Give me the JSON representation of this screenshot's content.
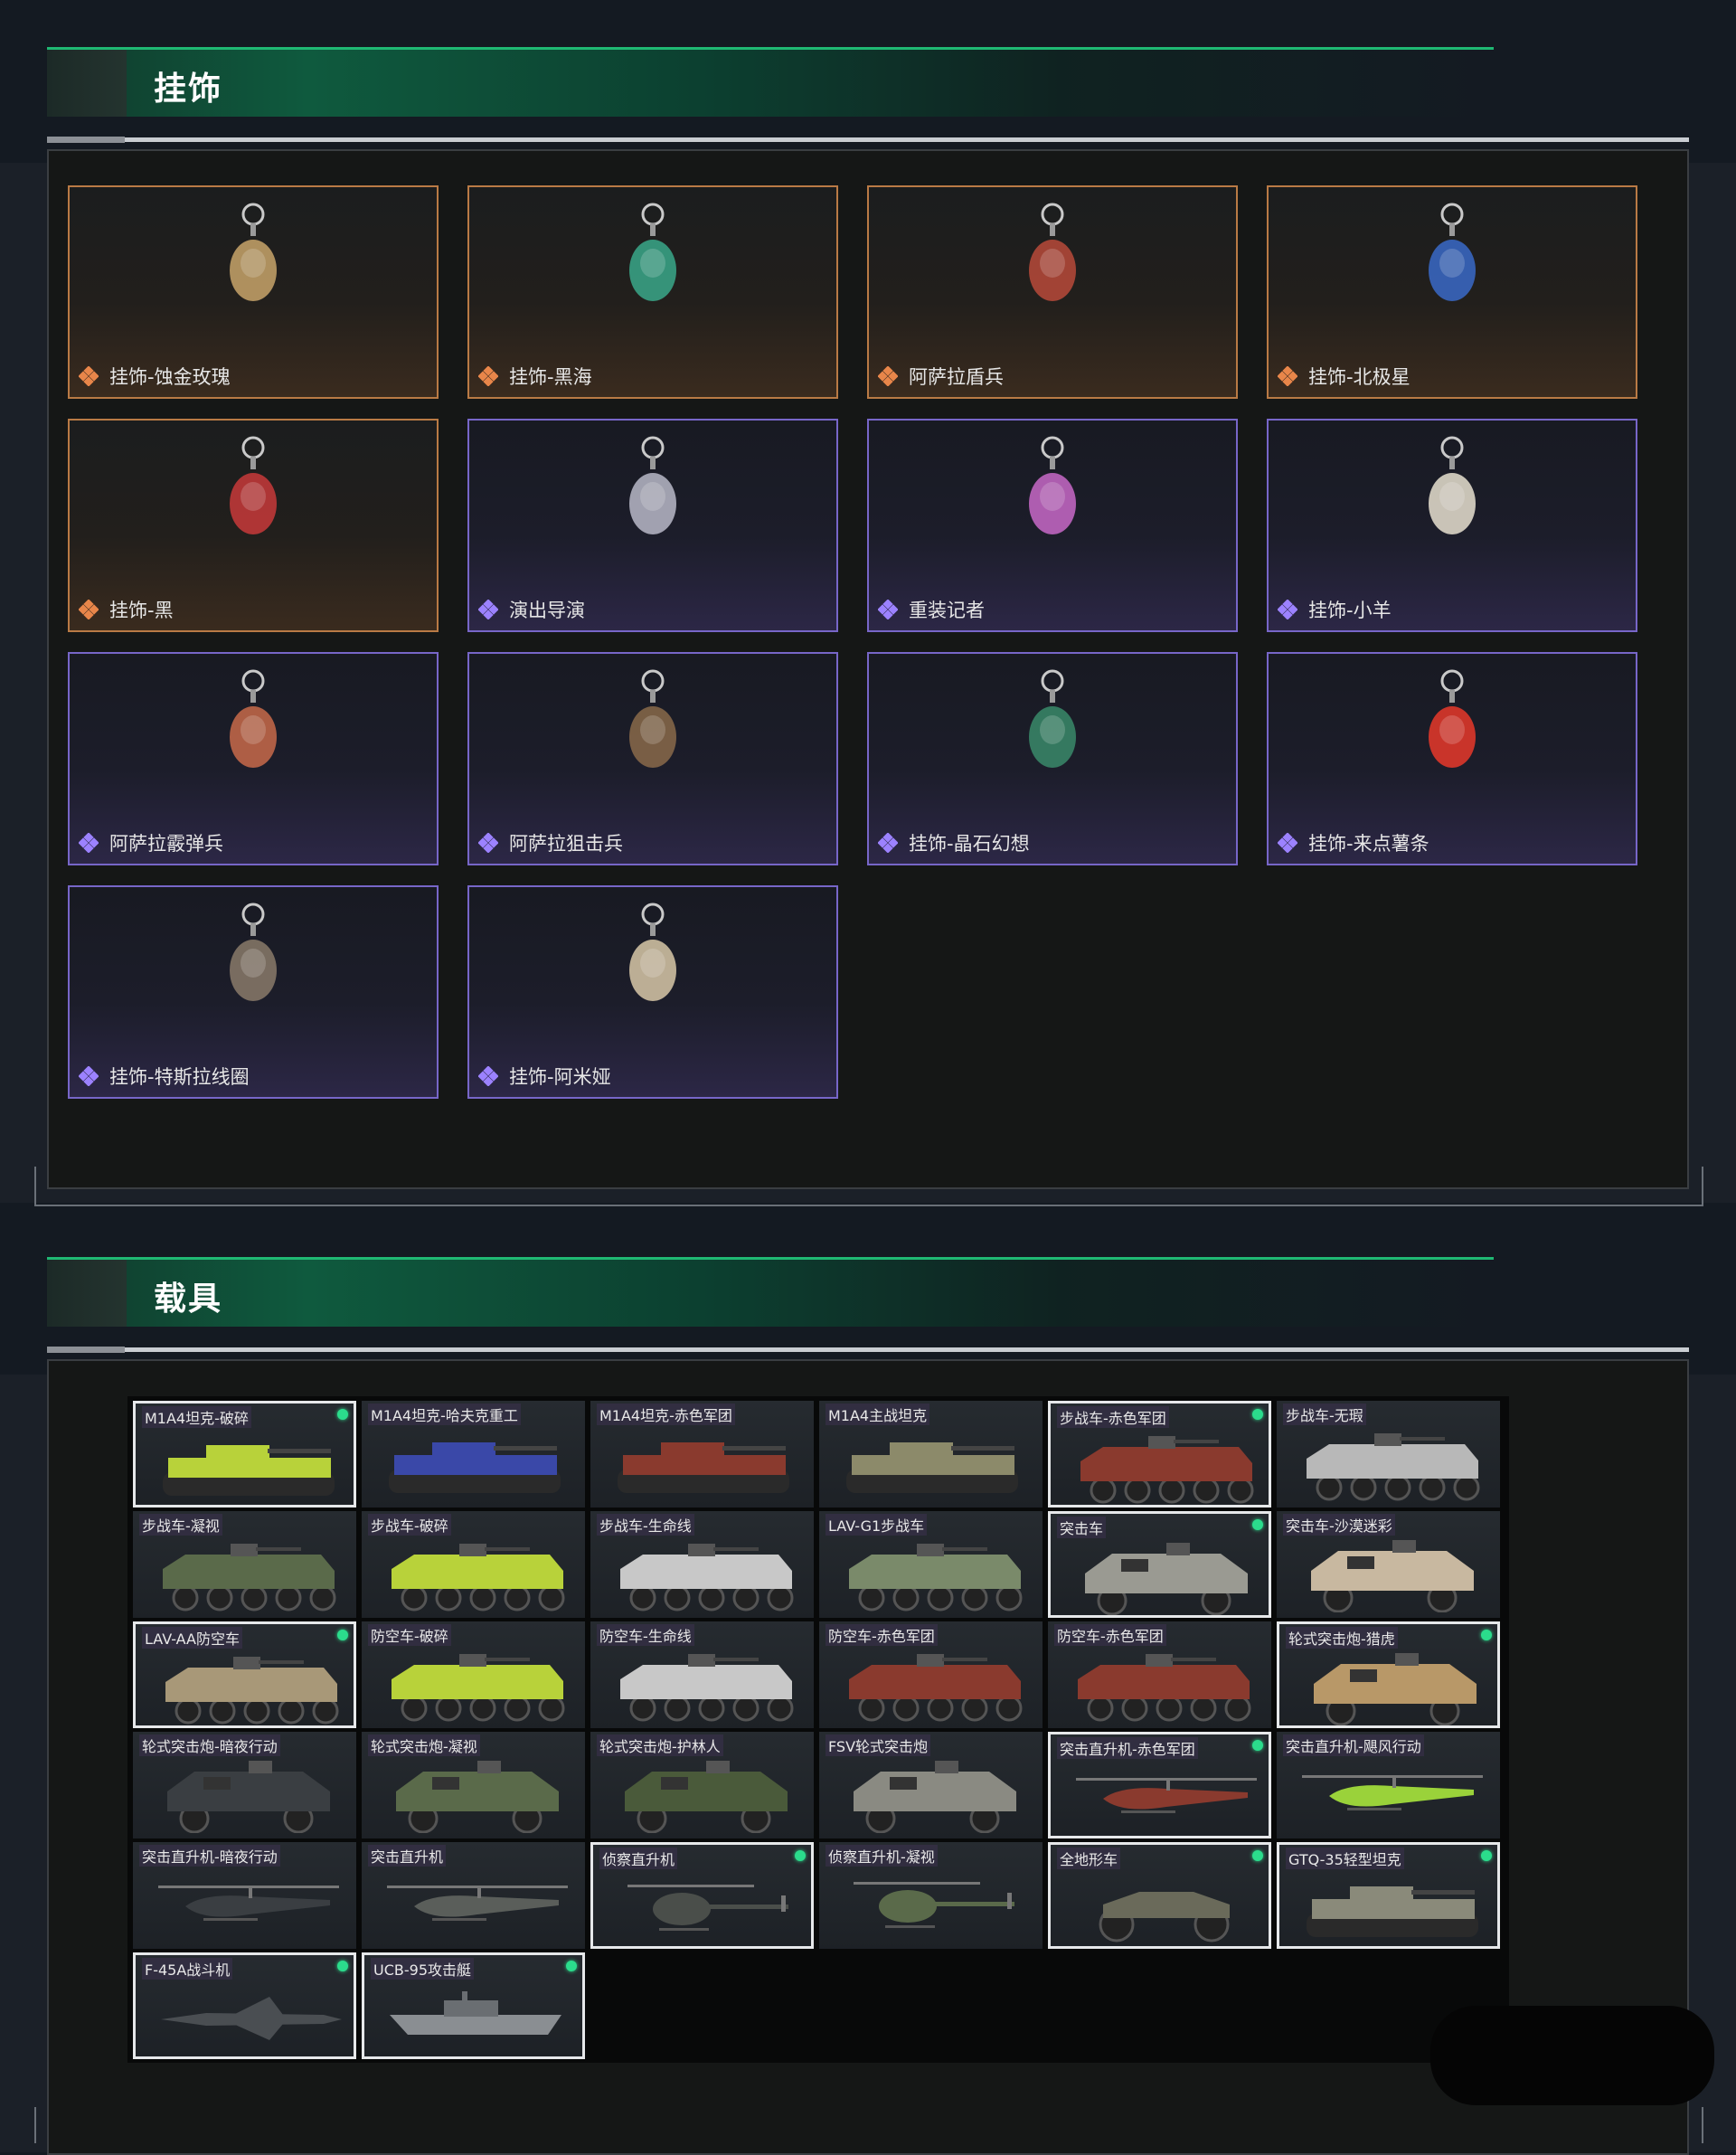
{
  "sections": {
    "charms": {
      "title": "挂饰"
    },
    "vehicles": {
      "title": "载具"
    }
  },
  "charms": [
    {
      "name": "挂饰-蚀金玫瑰",
      "rarity": "gold"
    },
    {
      "name": "挂饰-黑海",
      "rarity": "gold"
    },
    {
      "name": "阿萨拉盾兵",
      "rarity": "gold"
    },
    {
      "name": "挂饰-北极星",
      "rarity": "gold"
    },
    {
      "name": "挂饰-黑",
      "rarity": "gold"
    },
    {
      "name": "演出导演",
      "rarity": "purple"
    },
    {
      "name": "重装记者",
      "rarity": "purple"
    },
    {
      "name": "挂饰-小羊",
      "rarity": "purple"
    },
    {
      "name": "阿萨拉霰弹兵",
      "rarity": "purple"
    },
    {
      "name": "阿萨拉狙击兵",
      "rarity": "purple"
    },
    {
      "name": "挂饰-晶石幻想",
      "rarity": "purple"
    },
    {
      "name": "挂饰-来点薯条",
      "rarity": "purple"
    },
    {
      "name": "挂饰-特斯拉线圈",
      "rarity": "purple"
    },
    {
      "name": "挂饰-阿米娅",
      "rarity": "purple"
    }
  ],
  "vehicles": [
    {
      "name": "M1A4坦克-破碎",
      "selected": true,
      "kind": "tank",
      "color": "#b8d23a"
    },
    {
      "name": "M1A4坦克-哈夫克重工",
      "selected": false,
      "kind": "tank",
      "color": "#3a48a8"
    },
    {
      "name": "M1A4坦克-赤色军团",
      "selected": false,
      "kind": "tank",
      "color": "#8a3a2e"
    },
    {
      "name": "M1A4主战坦克",
      "selected": false,
      "kind": "tank",
      "color": "#8c8a6a"
    },
    {
      "name": "步战车-赤色军团",
      "selected": true,
      "kind": "ifv",
      "color": "#8a3a2e"
    },
    {
      "name": "步战车-无瑕",
      "selected": false,
      "kind": "ifv",
      "color": "#b8b8b8"
    },
    {
      "name": "步战车-凝视",
      "selected": false,
      "kind": "ifv",
      "color": "#5a6a4a"
    },
    {
      "name": "步战车-破碎",
      "selected": false,
      "kind": "ifv",
      "color": "#b8d23a"
    },
    {
      "name": "步战车-生命线",
      "selected": false,
      "kind": "ifv",
      "color": "#c8c8c8"
    },
    {
      "name": "LAV-G1步战车",
      "selected": false,
      "kind": "ifv",
      "color": "#7a8a6a"
    },
    {
      "name": "突击车",
      "selected": true,
      "kind": "truck",
      "color": "#9a9a92"
    },
    {
      "name": "突击车-沙漠迷彩",
      "selected": false,
      "kind": "truck",
      "color": "#c8b8a0"
    },
    {
      "name": "LAV-AA防空车",
      "selected": true,
      "kind": "ifv",
      "color": "#a89878"
    },
    {
      "name": "防空车-破碎",
      "selected": false,
      "kind": "ifv",
      "color": "#b8d23a"
    },
    {
      "name": "防空车-生命线",
      "selected": false,
      "kind": "ifv",
      "color": "#c8c8c8"
    },
    {
      "name": "防空车-赤色军团",
      "selected": false,
      "kind": "ifv",
      "color": "#8a3a2e"
    },
    {
      "name": "防空车-赤色军团",
      "selected": false,
      "kind": "ifv",
      "color": "#8a3a2e"
    },
    {
      "name": "轮式突击炮-猎虎",
      "selected": true,
      "kind": "truck",
      "color": "#b89868"
    },
    {
      "name": "轮式突击炮-暗夜行动",
      "selected": false,
      "kind": "truck",
      "color": "#3a3e42"
    },
    {
      "name": "轮式突击炮-凝视",
      "selected": false,
      "kind": "truck",
      "color": "#5a6a4a"
    },
    {
      "name": "轮式突击炮-护林人",
      "selected": false,
      "kind": "truck",
      "color": "#4a5a3a"
    },
    {
      "name": "FSV轮式突击炮",
      "selected": false,
      "kind": "truck",
      "color": "#8a8a82"
    },
    {
      "name": "突击直升机-赤色军团",
      "selected": true,
      "kind": "heli",
      "color": "#8a3a2e"
    },
    {
      "name": "突击直升机-飓风行动",
      "selected": false,
      "kind": "heli",
      "color": "#9ad23a"
    },
    {
      "name": "突击直升机-暗夜行动",
      "selected": false,
      "kind": "heli",
      "color": "#3a3e42"
    },
    {
      "name": "突击直升机",
      "selected": false,
      "kind": "heli",
      "color": "#5a5e5a"
    },
    {
      "name": "侦察直升机",
      "selected": true,
      "kind": "scout",
      "color": "#4a4e4a"
    },
    {
      "name": "侦察直升机-凝视",
      "selected": false,
      "kind": "scout",
      "color": "#5a6a4a"
    },
    {
      "name": "全地形车",
      "selected": true,
      "kind": "atv",
      "color": "#6a6a5a"
    },
    {
      "name": "GTQ-35轻型坦克",
      "selected": true,
      "kind": "tank",
      "color": "#8a8a7a"
    },
    {
      "name": "F-45A战斗机",
      "selected": true,
      "kind": "jet",
      "color": "#4a4e52"
    },
    {
      "name": "UCB-95攻击艇",
      "selected": true,
      "kind": "boat",
      "color": "#8a8e92"
    }
  ]
}
